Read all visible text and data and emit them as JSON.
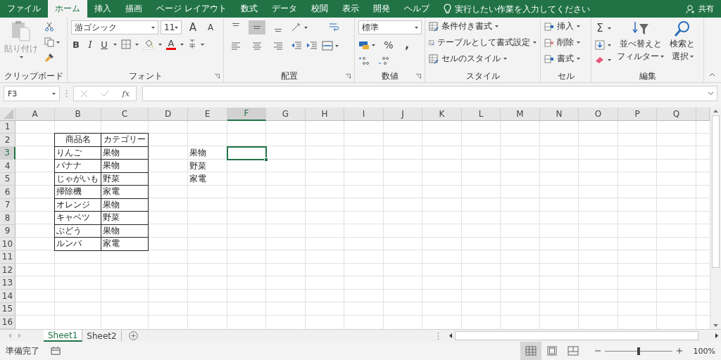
{
  "ribbon_tabs": [
    {
      "label": "ファイル",
      "selected": false
    },
    {
      "label": "ホーム",
      "selected": true
    },
    {
      "label": "挿入",
      "selected": false
    },
    {
      "label": "描画",
      "selected": false
    },
    {
      "label": "ページ レイアウト",
      "selected": false
    },
    {
      "label": "数式",
      "selected": false
    },
    {
      "label": "データ",
      "selected": false
    },
    {
      "label": "校閲",
      "selected": false
    },
    {
      "label": "表示",
      "selected": false
    },
    {
      "label": "開発",
      "selected": false
    },
    {
      "label": "ヘルプ",
      "selected": false
    }
  ],
  "tell_me": {
    "placeholder": "実行したい作業を入力してください"
  },
  "share": "共有",
  "ribbon": {
    "clipboard": {
      "label": "クリップボード",
      "paste": "貼り付け"
    },
    "font": {
      "label": "フォント",
      "name": "游ゴシック",
      "size": "11",
      "grow": "A",
      "shrink": "A",
      "bold": "B",
      "italic": "I",
      "underline": "U",
      "color_button": "A"
    },
    "alignment": {
      "label": "配置",
      "vertical": [
        {
          "kind": "top",
          "selected": false
        },
        {
          "kind": "middle",
          "selected": true
        },
        {
          "kind": "bottom",
          "selected": false
        }
      ]
    },
    "number": {
      "label": "数値",
      "format": "標準",
      "percent": "%",
      "comma": ","
    },
    "styles": {
      "label": "スタイル",
      "items": [
        "条件付き書式",
        "テーブルとして書式設定",
        "セルのスタイル"
      ]
    },
    "cells": {
      "label": "セル",
      "items": [
        "挿入",
        "削除",
        "書式"
      ]
    },
    "editing": {
      "label": "編集",
      "autosum": "Σ",
      "sort": [
        "並べ替えと",
        "フィルター"
      ],
      "find": [
        "検索と",
        "選択"
      ]
    }
  },
  "formula_bar": {
    "name_box": "F3",
    "fx": "fx"
  },
  "sheet": {
    "columns": [
      {
        "label": "A",
        "selected": false
      },
      {
        "label": "B",
        "selected": false
      },
      {
        "label": "C",
        "selected": false
      },
      {
        "label": "D",
        "selected": false
      },
      {
        "label": "E",
        "selected": false
      },
      {
        "label": "F",
        "selected": true
      },
      {
        "label": "G",
        "selected": false
      },
      {
        "label": "H",
        "selected": false
      },
      {
        "label": "I",
        "selected": false
      },
      {
        "label": "J",
        "selected": false
      },
      {
        "label": "K",
        "selected": false
      },
      {
        "label": "L",
        "selected": false
      },
      {
        "label": "M",
        "selected": false
      },
      {
        "label": "N",
        "selected": false
      },
      {
        "label": "O",
        "selected": false
      },
      {
        "label": "P",
        "selected": false
      },
      {
        "label": "Q",
        "selected": false
      }
    ],
    "rows": [
      {
        "label": "1",
        "selected": false
      },
      {
        "label": "2",
        "selected": false
      },
      {
        "label": "3",
        "selected": true
      },
      {
        "label": "4",
        "selected": false
      },
      {
        "label": "5",
        "selected": false
      },
      {
        "label": "6",
        "selected": false
      },
      {
        "label": "7",
        "selected": false
      },
      {
        "label": "8",
        "selected": false
      },
      {
        "label": "9",
        "selected": false
      },
      {
        "label": "10",
        "selected": false
      },
      {
        "label": "11",
        "selected": false
      },
      {
        "label": "12",
        "selected": false
      },
      {
        "label": "13",
        "selected": false
      },
      {
        "label": "14",
        "selected": false
      },
      {
        "label": "15",
        "selected": false
      },
      {
        "label": "16",
        "selected": false
      }
    ],
    "table": {
      "columns": [
        "商品名",
        "カテゴリー"
      ],
      "rows": [
        [
          "りんご",
          "果物"
        ],
        [
          "バナナ",
          "果物"
        ],
        [
          "じゃがいも",
          "野菜"
        ],
        [
          "掃除機",
          "家電"
        ],
        [
          "オレンジ",
          "果物"
        ],
        [
          "キャベツ",
          "野菜"
        ],
        [
          "ぶどう",
          "果物"
        ],
        [
          "ルンバ",
          "家電"
        ]
      ]
    },
    "list": [
      "果物",
      "野菜",
      "家電"
    ]
  },
  "sheet_tabs": [
    {
      "label": "Sheet1",
      "selected": true
    },
    {
      "label": "Sheet2",
      "selected": false
    }
  ],
  "status_bar": {
    "text": "準備完了",
    "views": [
      {
        "kind": "normal",
        "selected": true
      },
      {
        "kind": "page_layout",
        "selected": false
      },
      {
        "kind": "page_break",
        "selected": false
      }
    ],
    "zoom": {
      "level": 0.5
    },
    "zoom_text": "100%"
  }
}
